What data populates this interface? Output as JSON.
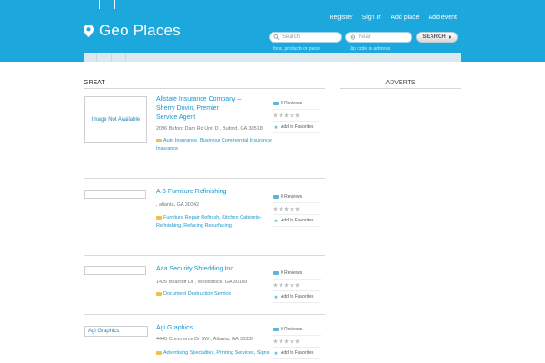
{
  "header": {
    "logo_text": "Geo Places",
    "nav": [
      "Register",
      "Sign In",
      "Add place",
      "Add event"
    ],
    "search": {
      "placeholder": "Search",
      "hint": "food, products or place",
      "near_placeholder": "Near",
      "near_hint": "Zip code or address",
      "button_label": "SEARCH"
    }
  },
  "main": {
    "section_title": "GREAT",
    "adverts_title": "ADVERTS"
  },
  "listings": [
    {
      "thumb_text": "Image Not Available",
      "title_lines": [
        "Allstate Insurance Company –",
        "Sherry Dovin, Premier",
        "Service Agent"
      ],
      "address": "2096 Buford Dam Rd Unit D , Buford, GA 30518",
      "categories": "Auto Insurance, Business Commercial Insurance, Insurance",
      "reviews": "0 Reviews",
      "favorites": "Add to Favorites",
      "rating": 0
    },
    {
      "thumb_text": "",
      "title_lines": [
        "A B Furniture Refinishing"
      ],
      "address": ", atlanta, GA 30342",
      "categories": "Furniture Repair Refinish, Kitchen Cabinets-Refinishing, Refacing Resurfacing",
      "reviews": "0 Reviews",
      "favorites": "Add to Favorites",
      "rating": 0
    },
    {
      "thumb_text": "",
      "title_lines": [
        "Aaa Security Shredding Inc"
      ],
      "address": "1426 Briarcliff Dr , Woodstock, GA 30189",
      "categories": "Document Destruction Service",
      "reviews": "0 Reviews",
      "favorites": "Add to Favorites",
      "rating": 0
    },
    {
      "thumb_text": "Agi Graphics",
      "title_lines": [
        "Agi Graphics"
      ],
      "address": "4445 Commerce Dr SW , Atlanta, GA 30336",
      "categories": "Advertising Specialties, Printing Services, Signs",
      "reviews": "0 Reviews",
      "favorites": "Add to Favorites",
      "rating": 0
    }
  ],
  "colors": {
    "header_bg": "#1ca8dd",
    "link": "#1a96cf"
  }
}
